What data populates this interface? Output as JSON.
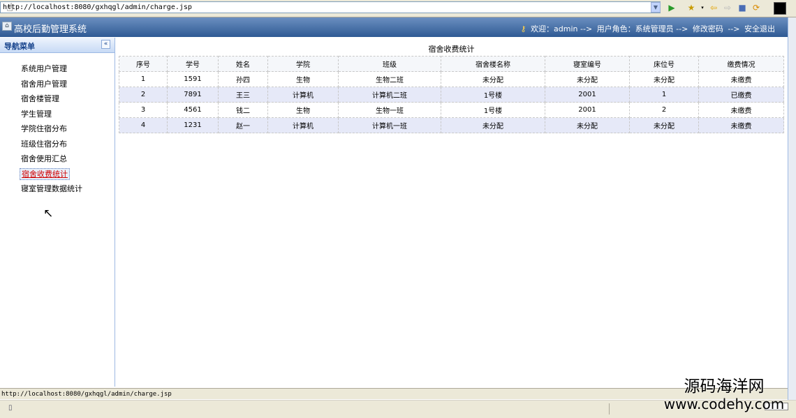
{
  "browser": {
    "url": "http://localhost:8080/gxhqgl/admin/charge.jsp",
    "status_url": "http://localhost:8080/gxhqgl/admin/charge.jsp"
  },
  "header": {
    "app_title": "高校后勤管理系统",
    "welcome": "欢迎：admin -->",
    "role": "用户角色：系统管理员 -->",
    "change_password": "修改密码",
    "arrow": "-->",
    "logout": "安全退出"
  },
  "sidebar": {
    "title": "导航菜单",
    "collapse": "«",
    "items": [
      {
        "label": "系统用户管理"
      },
      {
        "label": "宿舍用户管理"
      },
      {
        "label": "宿舍楼管理"
      },
      {
        "label": "学生管理"
      },
      {
        "label": "学院住宿分布"
      },
      {
        "label": "班级住宿分布"
      },
      {
        "label": "宿舍使用汇总"
      },
      {
        "label": "宿舍收费统计"
      },
      {
        "label": "寝室管理数据统计"
      }
    ]
  },
  "grid": {
    "title": "宿舍收费统计",
    "columns": [
      "序号",
      "学号",
      "姓名",
      "学院",
      "班级",
      "宿舍楼名称",
      "寝室编号",
      "床位号",
      "缴费情况"
    ],
    "rows": [
      [
        "1",
        "1591",
        "孙四",
        "生物",
        "生物二班",
        "未分配",
        "未分配",
        "未分配",
        "未缴费"
      ],
      [
        "2",
        "7891",
        "王三",
        "计算机",
        "计算机二班",
        "1号楼",
        "2001",
        "1",
        "已缴费"
      ],
      [
        "3",
        "4561",
        "钱二",
        "生物",
        "生物一班",
        "1号楼",
        "2001",
        "2",
        "未缴费"
      ],
      [
        "4",
        "1231",
        "赵一",
        "计算机",
        "计算机一班",
        "未分配",
        "未分配",
        "未分配",
        "未缴费"
      ]
    ]
  },
  "watermark": {
    "line1": "源码海洋网",
    "line2": "www.codehy.com"
  },
  "colors": {
    "header_bg": "#2f5a94",
    "active_menu": "#d00000",
    "alt_row": "#e6e9f8"
  }
}
